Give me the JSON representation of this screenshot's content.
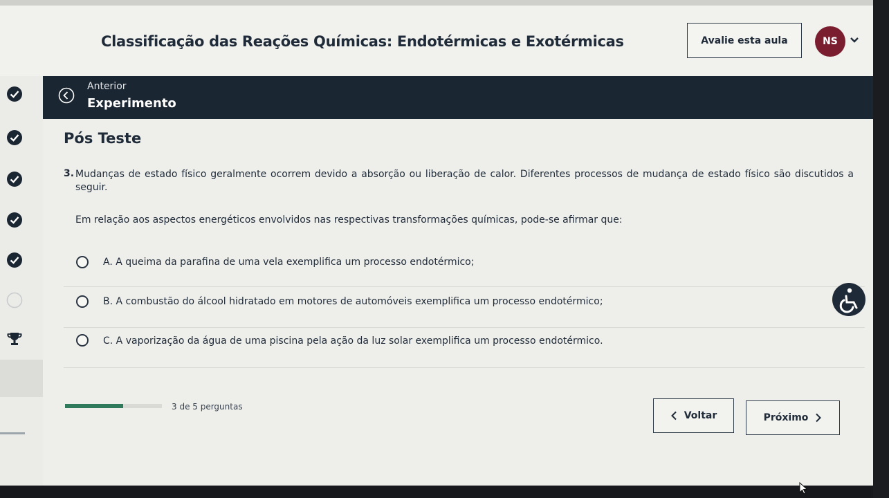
{
  "header": {
    "course_title": "Classificação das Reações Químicas: Endotérmicas e Exotérmicas",
    "rate_button": "Avalie esta aula",
    "avatar_initials": "NS"
  },
  "nav": {
    "previous_label": "Anterior",
    "previous_title": "Experimento"
  },
  "section_title": "Pós Teste",
  "question": {
    "number": "3.",
    "text": "Mudanças de estado físico geralmente ocorrem devido a absorção ou liberação de calor. Diferentes processos de mudança de estado físico são discutidos a seguir.",
    "prompt": "Em relação aos aspectos energéticos envolvidos nas respectivas transformações químicas, pode-se afirmar que:"
  },
  "options": [
    {
      "label": "A. A queima da parafina de uma vela exemplifica um processo endotérmico;"
    },
    {
      "label": "B. A combustão do álcool hidratado em motores de automóveis exemplifica um processo endotérmico;"
    },
    {
      "label": "C. A vaporização da água de uma piscina pela ação da luz solar exemplifica um processo endotérmico."
    }
  ],
  "progress": {
    "label": "3 de 5 perguntas",
    "fraction": 0.6
  },
  "buttons": {
    "back": "Voltar",
    "next": "Próximo"
  },
  "sidebar": {
    "icons": [
      "check-circle-icon",
      "check-circle-icon",
      "check-circle-icon",
      "check-circle-icon",
      "check-circle-icon",
      "empty-circle-icon",
      "trophy-icon"
    ]
  },
  "colors": {
    "nav_dark": "#1b2633",
    "avatar": "#7a1d2e",
    "progress": "#2f7a5a"
  }
}
